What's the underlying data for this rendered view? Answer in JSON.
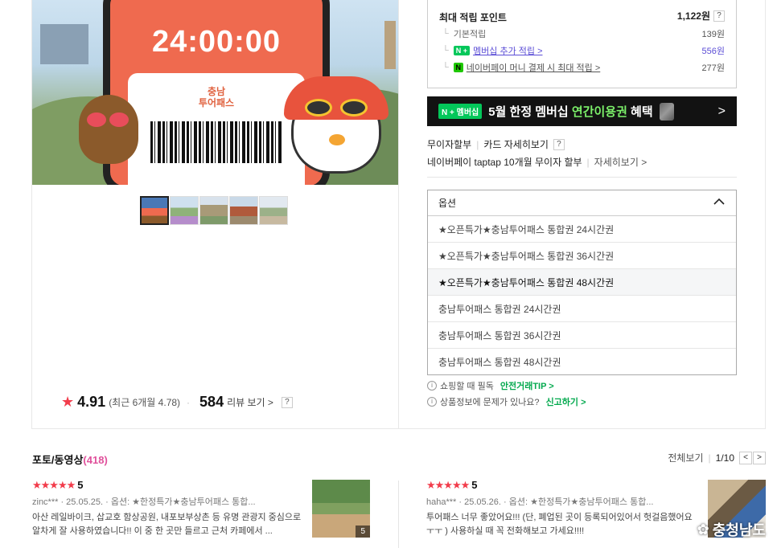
{
  "product": {
    "ticket_timer": "24:00:00",
    "ticket_logo": "충남\n투어패스",
    "rating": {
      "score": "4.91",
      "recent": "(최근 6개월 4.78)",
      "review_count": "584",
      "review_link": "리뷰 보기 >",
      "help": "?"
    }
  },
  "points": {
    "title": "최대 적립 포인트",
    "total": "1,122원",
    "help": "?",
    "rows": [
      {
        "label": "기본적립",
        "amount": "139원"
      },
      {
        "badge": "N +",
        "label": "멤버십 추가 적립 >",
        "amount": "556원"
      },
      {
        "badge": "N",
        "label": "네이버페이 머니 결제 시 최대 적립 >",
        "amount": "277원"
      }
    ]
  },
  "banner": {
    "badge": "N + 멤버십",
    "text_pre": "5월 한정 멤버십 ",
    "text_highlight": "연간이용권",
    "text_post": " 혜택",
    "arrow": ">"
  },
  "installment": {
    "row1_a": "무이자할부",
    "row1_b": "카드 자세히보기",
    "row1_help": "?",
    "row2_a": "네이버페이 taptap 10개월 무이자 할부",
    "row2_b": "자세히보기 >"
  },
  "options": {
    "label": "옵션",
    "items": [
      "★오픈특가★충남투어패스 통합권 24시간권",
      "★오픈특가★충남투어패스 통합권 36시간권",
      "★오픈특가★충남투어패스 통합권 48시간권",
      "충남투어패스 통합권 24시간권",
      "충남투어패스 통합권 36시간권",
      "충남투어패스 통합권 48시간권"
    ]
  },
  "notices": [
    {
      "icon": "i",
      "text": "쇼핑할 때 필독",
      "link": "안전거래TIP >"
    },
    {
      "icon": "i",
      "text": "상품정보에 문제가 있나요?",
      "link": "신고하기 >"
    }
  ],
  "photo_reviews": {
    "title": "포토/동영상",
    "count": "(418)",
    "all": "전체보기",
    "pager": "1/10",
    "prev": "<",
    "next": ">",
    "reviews": [
      {
        "stars": "★★★★★",
        "score": "5",
        "meta": "zinc***  ·  25.05.25.  ·  옵션: ★한정특가★충남투어패스 통합...",
        "body": "아산 레일바이크, 삽교호 함상공원, 내포보부상촌 등 유명 관광지 중심으로 알차게 잘 사용하였습니다!! 이 중 한 곳만 들르고 근처 카페에서 ...",
        "img_count": "5"
      },
      {
        "stars": "★★★★★",
        "score": "5",
        "meta": "haha***  ·  25.05.26.  ·  옵션: ★한정특가★충남투어패스 통합...",
        "body": "투어패스 너무 좋았어요!!! (단, 폐업된 곳이 등록되어있어서 헛걸음했어요 ㅜㅜ ) 사용하실 때 꼭 전화해보고 가세요!!!!",
        "watermark": "충청남도"
      }
    ]
  },
  "colors": {
    "accent_red": "#f23c4b",
    "naver_green": "#03c75a",
    "purple_link": "#5b4dd6",
    "pink_count": "#e0509b",
    "ticket_orange": "#ef6a4f"
  }
}
